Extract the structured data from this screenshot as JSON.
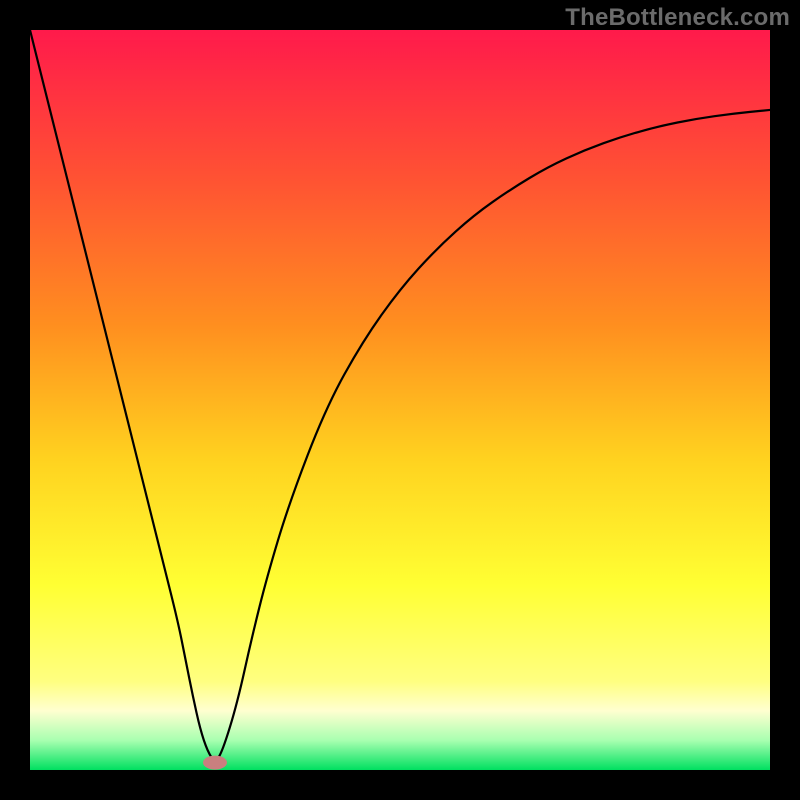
{
  "watermark": "TheBottleneck.com",
  "chart_data": {
    "type": "line",
    "title": "",
    "xlabel": "",
    "ylabel": "",
    "xlim": [
      0,
      100
    ],
    "ylim": [
      0,
      100
    ],
    "x": [
      0,
      2,
      4,
      6,
      8,
      10,
      12,
      14,
      16,
      18,
      20,
      21,
      22,
      23,
      24,
      25,
      26,
      28,
      30,
      32,
      35,
      40,
      45,
      50,
      55,
      60,
      65,
      70,
      75,
      80,
      85,
      90,
      95,
      100
    ],
    "values": [
      100,
      92,
      84,
      76,
      68,
      60,
      52,
      44,
      36,
      28,
      20,
      15,
      10,
      5.5,
      2.5,
      1,
      2.5,
      9,
      18,
      26,
      36,
      49,
      58,
      65,
      70.5,
      75,
      78.5,
      81.5,
      83.8,
      85.6,
      87,
      88,
      88.7,
      89.2
    ],
    "optimum_x": 25,
    "gradient_stops": [
      {
        "offset": 0.0,
        "color": "#ff1a4b"
      },
      {
        "offset": 0.2,
        "color": "#ff5233"
      },
      {
        "offset": 0.4,
        "color": "#ff8f1f"
      },
      {
        "offset": 0.58,
        "color": "#ffd21f"
      },
      {
        "offset": 0.75,
        "color": "#ffff33"
      },
      {
        "offset": 0.88,
        "color": "#ffff80"
      },
      {
        "offset": 0.92,
        "color": "#ffffd0"
      },
      {
        "offset": 0.96,
        "color": "#a8ffb0"
      },
      {
        "offset": 1.0,
        "color": "#00e060"
      }
    ],
    "marker": {
      "x": 25,
      "y": 1,
      "color": "#c97f7f",
      "rx": 12,
      "ry": 7
    }
  }
}
